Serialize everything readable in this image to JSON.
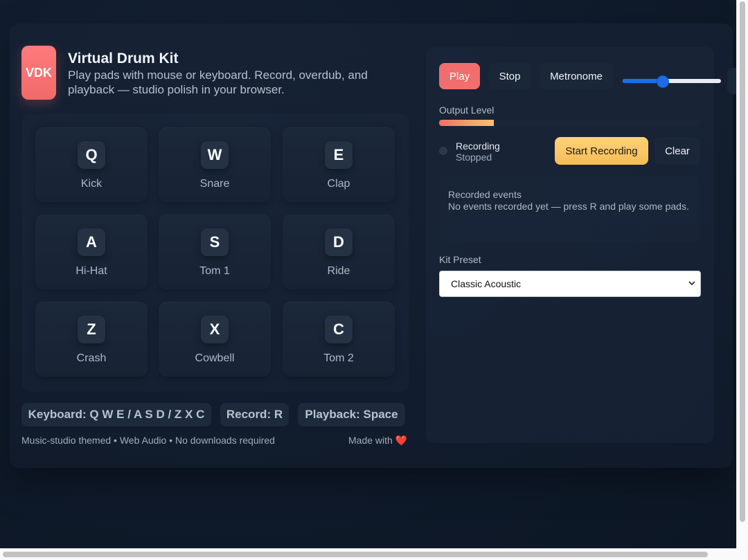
{
  "app": {
    "logo": "VDK",
    "title": "Virtual Drum Kit",
    "subtitle": "Play pads with mouse or keyboard. Record, overdub, and playback — studio polish in your browser."
  },
  "pads": [
    {
      "key": "Q",
      "name": "Kick"
    },
    {
      "key": "W",
      "name": "Snare"
    },
    {
      "key": "E",
      "name": "Clap"
    },
    {
      "key": "A",
      "name": "Hi-Hat"
    },
    {
      "key": "S",
      "name": "Tom 1"
    },
    {
      "key": "D",
      "name": "Ride"
    },
    {
      "key": "Z",
      "name": "Crash"
    },
    {
      "key": "X",
      "name": "Cowbell"
    },
    {
      "key": "C",
      "name": "Tom 2"
    }
  ],
  "hints": {
    "keyboard": "Keyboard: Q W E / A S D / Z X C",
    "record": "Record: R",
    "playback": "Playback: Space"
  },
  "footer": {
    "left": "Music-studio themed • Web Audio • No downloads required",
    "right": "Made with",
    "heart": "❤️"
  },
  "transport": {
    "play": "Play",
    "stop": "Stop",
    "metronome": "Metronome",
    "volume_fraction": 0.4
  },
  "output": {
    "label": "Output Level",
    "level_fraction": 0.21
  },
  "recording": {
    "title": "Recording",
    "status": "Stopped",
    "start_label": "Start Recording",
    "clear_label": "Clear"
  },
  "events": {
    "title": "Recorded events",
    "message": "No events recorded yet — press R and play some pads."
  },
  "kit": {
    "label": "Kit Preset",
    "selected": "Classic Acoustic"
  },
  "colors": {
    "accent_play": "#f26d6d",
    "accent_record": "#f6bc57",
    "slider": "#1e6de6"
  }
}
